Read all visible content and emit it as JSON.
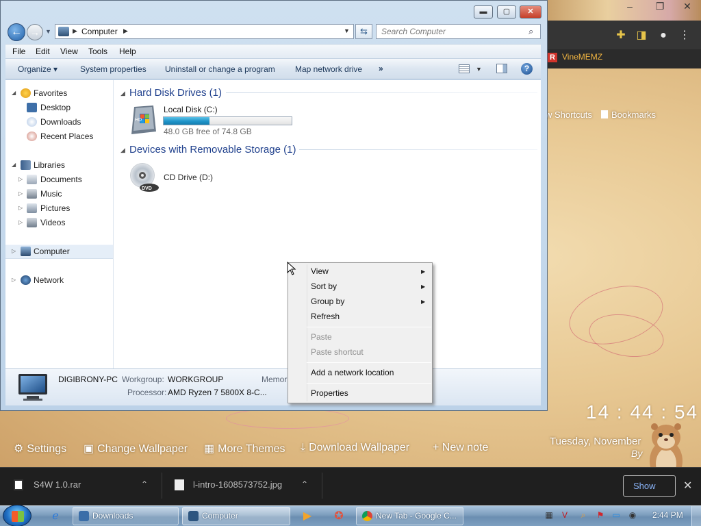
{
  "explorer": {
    "window_controls": {
      "minimize": "▬",
      "maximize": "▢",
      "close": "✕"
    },
    "address": {
      "location": "Computer"
    },
    "search": {
      "placeholder": "Search Computer"
    },
    "menu": [
      "File",
      "Edit",
      "View",
      "Tools",
      "Help"
    ],
    "commands": [
      "Organize ▾",
      "System properties",
      "Uninstall or change a program",
      "Map network drive",
      "»"
    ],
    "nav": {
      "favorites": "Favorites",
      "favorites_items": [
        "Desktop",
        "Downloads",
        "Recent Places"
      ],
      "libraries": "Libraries",
      "libraries_items": [
        "Documents",
        "Music",
        "Pictures",
        "Videos"
      ],
      "computer": "Computer",
      "network": "Network"
    },
    "groups": [
      {
        "title": "Hard Disk Drives (1)"
      },
      {
        "title": "Devices with Removable Storage (1)"
      }
    ],
    "drives": {
      "c": {
        "label": "Local Disk (C:)",
        "free_text": "48.0 GB free of 74.8 GB",
        "used_fraction": 0.358
      },
      "d": {
        "label": "CD Drive (D:)"
      }
    },
    "details": {
      "computer_name": "DIGIBRONY-PC",
      "workgroup_label": "Workgroup:",
      "workgroup": "WORKGROUP",
      "memory_label": "Memor",
      "processor_label": "Processor:",
      "processor": "AMD Ryzen 7 5800X 8-C..."
    }
  },
  "context_menu": {
    "items": [
      {
        "label": "View",
        "submenu": true,
        "enabled": true
      },
      {
        "label": "Sort by",
        "submenu": true,
        "enabled": true
      },
      {
        "label": "Group by",
        "submenu": true,
        "enabled": true
      },
      {
        "label": "Refresh",
        "submenu": false,
        "enabled": true
      },
      {
        "label": "Paste",
        "submenu": false,
        "enabled": false
      },
      {
        "label": "Paste shortcut",
        "submenu": false,
        "enabled": false
      },
      {
        "label": "Add a network location",
        "submenu": false,
        "enabled": true
      },
      {
        "label": "Properties",
        "submenu": false,
        "enabled": true
      }
    ]
  },
  "chrome": {
    "bookmark": "VineMEMZ",
    "shortcuts": "w Shortcuts",
    "bookmarks": "Bookmarks",
    "clock": "14 : 44 : 54",
    "date": "Tuesday, November",
    "byline": "By",
    "ntp_links": [
      "Settings",
      "Change Wallpaper",
      "More Themes",
      "Download Wallpaper",
      "+ New note"
    ]
  },
  "download_shelf": {
    "items": [
      "S4W 1.0.rar",
      "l-intro-1608573752.jpg"
    ],
    "show_all": "Show"
  },
  "taskbar": {
    "buttons": [
      "Downloads",
      "Computer",
      "New Tab - Google C..."
    ],
    "time": "2:44 PM"
  },
  "colors": {
    "progress_fill": "#1f94c9",
    "group_heading": "#1e3f8c",
    "vinememz": "#f0b441"
  }
}
